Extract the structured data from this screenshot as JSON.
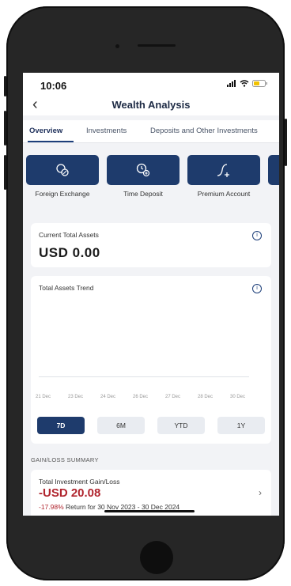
{
  "status": {
    "time": "10:06"
  },
  "header": {
    "title": "Wealth Analysis"
  },
  "tabs": [
    {
      "label": "Overview",
      "active": true
    },
    {
      "label": "Investments",
      "active": false
    },
    {
      "label": "Deposits and Other Investments",
      "active": false
    }
  ],
  "quick_actions": [
    {
      "label": "Foreign Exchange",
      "icon": "exchange-icon"
    },
    {
      "label": "Time Deposit",
      "icon": "clock-plus-icon"
    },
    {
      "label": "Premium Account",
      "icon": "premium-chart-icon"
    }
  ],
  "total_assets": {
    "label": "Current Total Assets",
    "value": "USD 0.00"
  },
  "trend": {
    "label": "Total Assets Trend",
    "dates": [
      "21 Dec",
      "23 Dec",
      "24 Dec",
      "26 Dec",
      "27 Dec",
      "28 Dec",
      "30 Dec"
    ],
    "periods": [
      {
        "label": "7D",
        "active": true
      },
      {
        "label": "6M",
        "active": false
      },
      {
        "label": "YTD",
        "active": false
      },
      {
        "label": "1Y",
        "active": false
      }
    ]
  },
  "gain_loss": {
    "section_title": "GAIN/LOSS SUMMARY",
    "label": "Total Investment Gain/Loss",
    "value": "-USD 20.08",
    "return_pct": "-17.98%",
    "return_text": " Return for 30 Nov 2023 - 30 Dec 2024"
  },
  "colors": {
    "accent": "#1e3b6c",
    "negative": "#b0252e",
    "background": "#f2f3f6"
  }
}
